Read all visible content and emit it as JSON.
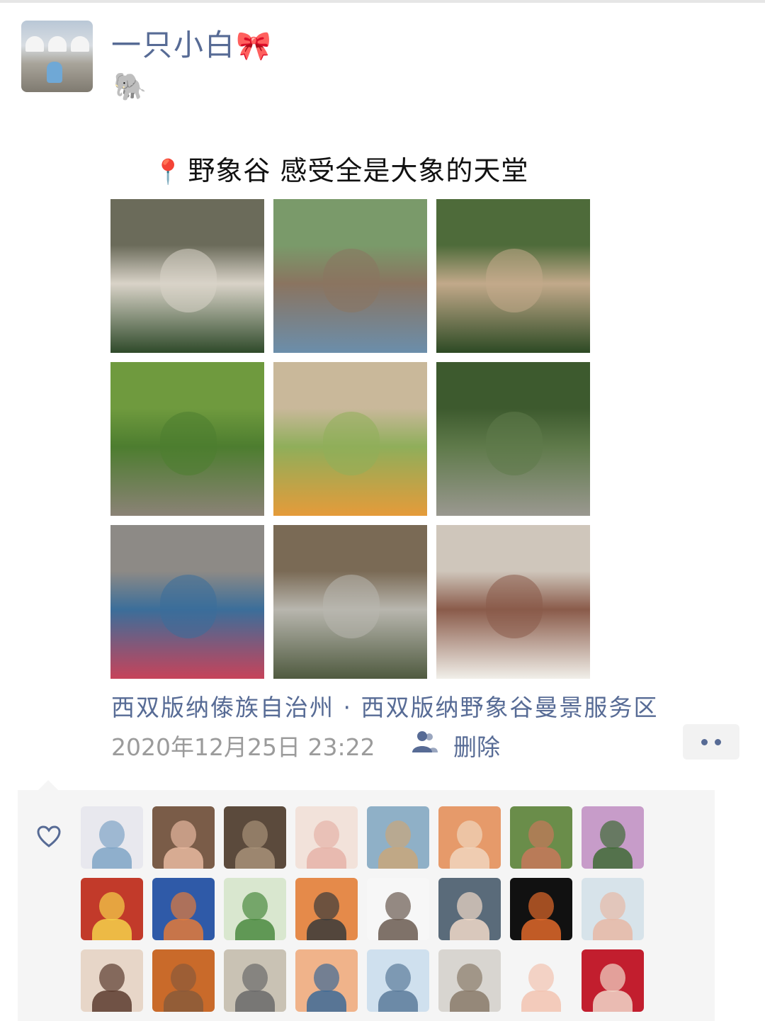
{
  "post": {
    "username": "一只小白",
    "username_emoji": "🎀",
    "subtitle_emoji": "🐘",
    "pin_emoji": "📍",
    "text": "野象谷  感受全是大象的天堂",
    "location": "西双版纳傣族自治州 · 西双版纳野象谷曼景服务区",
    "timestamp": "2020年12月25日 23:22",
    "privacy_icon": "friends-icon",
    "delete_label": "删除"
  },
  "photos": [
    {
      "name": "people-legs-photo",
      "colors": [
        "#6b6b5a",
        "#d9d3c8",
        "#2f4a2a"
      ]
    },
    {
      "name": "elephant-show-photo",
      "colors": [
        "#7a9a6a",
        "#8a7460",
        "#6b8eab"
      ]
    },
    {
      "name": "child-on-path-photo",
      "colors": [
        "#4e6b3a",
        "#c2a98a",
        "#2d4a24"
      ]
    },
    {
      "name": "grass-elephant-photo",
      "colors": [
        "#6f9a3e",
        "#4d7d2f",
        "#8b8276"
      ]
    },
    {
      "name": "fruit-platter-photo",
      "colors": [
        "#c9b89a",
        "#8fae5a",
        "#e59b3a"
      ]
    },
    {
      "name": "forest-elephant-photo",
      "colors": [
        "#3d5a2e",
        "#5f7a4a",
        "#9a9890"
      ]
    },
    {
      "name": "lotus-pond-photo",
      "colors": [
        "#8d8a86",
        "#3b6e9a",
        "#c7435a"
      ]
    },
    {
      "name": "child-walking-photo",
      "colors": [
        "#7a6a55",
        "#b8b6ae",
        "#4f5a3f"
      ]
    },
    {
      "name": "family-selfie-photo",
      "colors": [
        "#cfc6bb",
        "#8a5b4a",
        "#f1efe9"
      ]
    }
  ],
  "likes": {
    "heart_icon": "heart-outline-icon",
    "avatars": [
      {
        "colors": [
          "#e8e8ee",
          "#7fa4c6"
        ]
      },
      {
        "colors": [
          "#7a5c48",
          "#e7b8a0"
        ]
      },
      {
        "colors": [
          "#5b4a3c",
          "#a89178"
        ]
      },
      {
        "colors": [
          "#f2e2da",
          "#e6b3a8"
        ]
      },
      {
        "colors": [
          "#8fb0c7",
          "#c9a77a"
        ]
      },
      {
        "colors": [
          "#e69a6a",
          "#f0d5bd"
        ]
      },
      {
        "colors": [
          "#6a8d4a",
          "#c7785a"
        ]
      },
      {
        "colors": [
          "#c79cc9",
          "#3f6b36"
        ]
      },
      {
        "colors": [
          "#c23a2a",
          "#f5d14a"
        ]
      },
      {
        "colors": [
          "#2f5aa8",
          "#e27a3a"
        ]
      },
      {
        "colors": [
          "#d9e7cf",
          "#4a8a3f"
        ]
      },
      {
        "colors": [
          "#e58a4a",
          "#3a3a3a"
        ]
      },
      {
        "colors": [
          "#f7f7f7",
          "#6a5a50"
        ]
      },
      {
        "colors": [
          "#5a6b7a",
          "#f0d8c8"
        ]
      },
      {
        "colors": [
          "#111111",
          "#e0682a"
        ]
      },
      {
        "colors": [
          "#d7e3ea",
          "#e7b9a6"
        ]
      },
      {
        "colors": [
          "#e7d6c8",
          "#5a3b2e"
        ]
      },
      {
        "colors": [
          "#c96a2a",
          "#8a5a3a"
        ]
      },
      {
        "colors": [
          "#c9c2b4",
          "#6a6a6a"
        ]
      },
      {
        "colors": [
          "#f0b38a",
          "#3d6a96"
        ]
      },
      {
        "colors": [
          "#cfe0ee",
          "#5a7a9a"
        ]
      },
      {
        "colors": [
          "#d8d5d0",
          "#8a7a6a"
        ]
      },
      {
        "colors": [
          "#f5f5f5",
          "#f2c3b0"
        ]
      },
      {
        "colors": [
          "#c21e2e",
          "#f1d7c9"
        ]
      }
    ]
  }
}
